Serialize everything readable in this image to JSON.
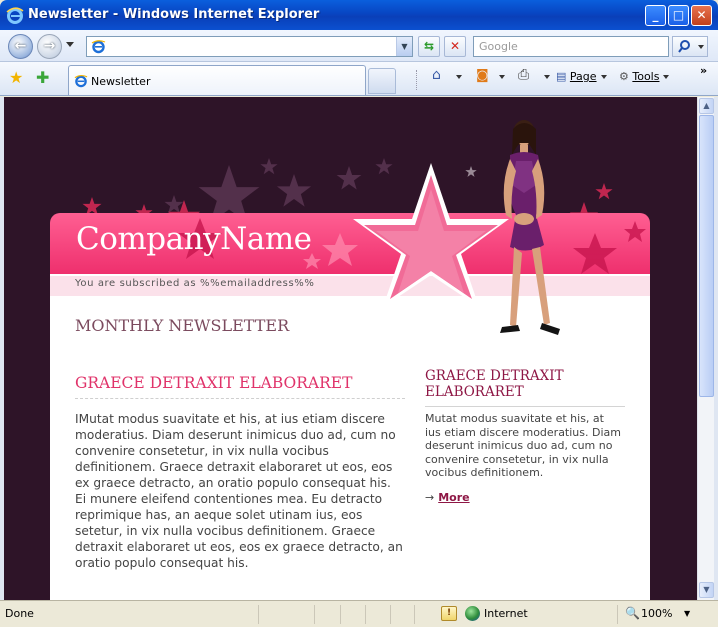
{
  "window": {
    "title": "Newsletter - Windows Internet Explorer"
  },
  "address_bar": {
    "value": ""
  },
  "search": {
    "placeholder": "Google"
  },
  "tab": {
    "label": "Newsletter"
  },
  "commands": {
    "page": "Page",
    "tools": "Tools"
  },
  "page": {
    "company_name": "CompanyName",
    "subscribed_text": "You are subscribed as %%emailaddress%%",
    "newsletter_heading": "MONTHLY NEWSLETTER",
    "left_heading": "GRAECE DETRAXIT ELABORARET",
    "left_body": "IMutat modus suavitate et his, at ius etiam discere moderatius. Diam deserunt inimicus duo ad, cum no convenire consetetur, in vix nulla vocibus definitionem. Graece detraxit elaboraret ut eos, eos ex graece detracto, an oratio populo consequat his. Ei munere eleifend contentiones mea. Eu detracto reprimique has, an aeque solet utinam ius, eos setetur, in vix nulla vocibus definitionem. Graece detraxit elaboraret ut eos, eos ex graece detracto, an oratio populo consequat his.",
    "right_heading": "GRAECE DETRAXIT ELABORARET",
    "right_body": "Mutat modus suavitate et his, at ius etiam discere moderatius. Diam deserunt inimicus duo ad, cum no convenire consetetur, in vix nulla vocibus definitionem.",
    "more_link": "More"
  },
  "status": {
    "text": "Done",
    "zone": "Internet",
    "zoom": "100%"
  },
  "colors": {
    "accent_pink": "#ee2f6d",
    "background": "#2e1428",
    "heading_maroon": "#8e1745"
  }
}
